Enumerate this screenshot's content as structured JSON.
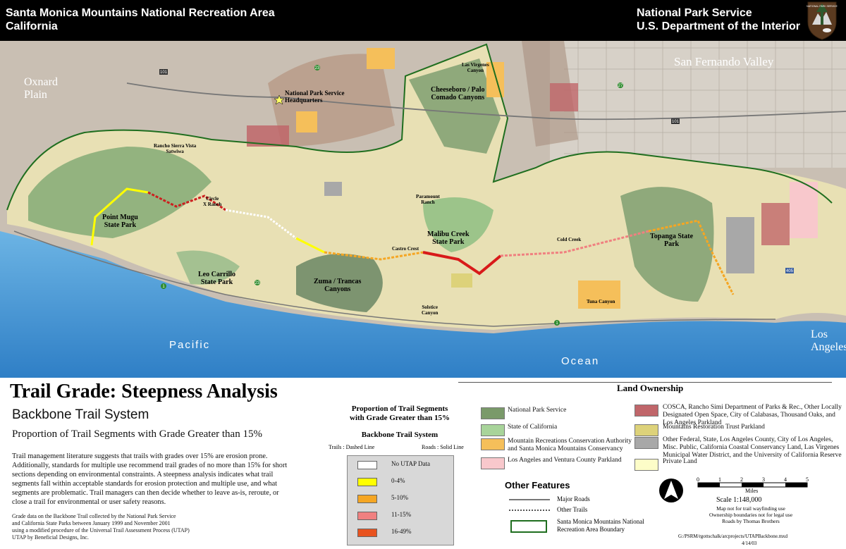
{
  "header": {
    "left_line1": "Santa Monica Mountains National Recreation Area",
    "left_line2": "California",
    "right_line1": "National Park Service",
    "right_line2": "U.S. Department of the Interior",
    "logo_text": "NATIONAL PARK SERVICE"
  },
  "map_labels": {
    "oxnard": "Oxnard\nPlain",
    "sfv": "San Fernando Valley",
    "los_angeles": "Los\nAngeles",
    "pacific": "Pacific",
    "ocean": "Ocean",
    "hq": "National Park Service\nHeadquarters",
    "las_virgenes": "Las Virgenes\nCanyon",
    "cheeseboro": "Cheeseboro / Palo\nComado Canyons",
    "rancho": "Rancho Sierra Vista\nSatwiwa",
    "circle_x": "Circle\nX Ranch",
    "point_mugu": "Point Mugu\nState Park",
    "paramount": "Paramount\nRanch",
    "malibu_creek": "Malibu Creek\nState Park",
    "castro_crest": "Castro Crest",
    "cold_creek": "Cold Creek",
    "topanga": "Topanga State\nPark",
    "leo_carrillo": "Leo Carrillo\nState Park",
    "zuma": "Zuma / Trancas\nCanyons",
    "solstice": "Solstice\nCanyon",
    "tuna": "Tuna Canyon",
    "hwy_101a": "101",
    "hwy_101b": "101",
    "hwy_23": "23",
    "hwy_27": "27",
    "hwy_1a": "1",
    "hwy_1b": "1",
    "hwy_23b": "23",
    "hwy_405": "405"
  },
  "title_block": {
    "title": "Trail Grade:  Steepness Analysis",
    "subtitle": "Backbone Trail System",
    "subtitle2": "Proportion of Trail Segments with Grade Greater than 15%",
    "description": "Trail management literature suggests that trails with grades over 15% are erosion prone. Additionally, standards for multiple use recommend trail grades of no more than 15% for short sections depending on environmental constraints.  A steepness analysis indicates what trail segments fall within acceptable standards for erosion protection and multiple use, and what segments are problematic.  Trail managers can then decide whether to leave as-is, reroute, or close a trail for environmental or user safety reasons.",
    "credits": "Grade data on the Backbone Trail collected by the National Park Service\nand California State Parks between January 1999 and November 2001\nusing a modified procedure of the Universal Trail Assessment Process (UTAP)\nUTAP by Beneficial Designs, Inc."
  },
  "grade_legend": {
    "heading": "Proportion of Trail Segments\nwith Grade Greater than 15%",
    "system": "Backbone Trail System",
    "trails_note": "Trails : Dashed Line",
    "roads_note": "Roads : Solid Line",
    "items": [
      {
        "label": "No UTAP Data",
        "color": "#ffffff"
      },
      {
        "label": "0-4%",
        "color": "#ffff00"
      },
      {
        "label": "5-10%",
        "color": "#f5a623"
      },
      {
        "label": "11-15%",
        "color": "#f08080"
      },
      {
        "label": "16-49%",
        "color": "#e8531f"
      }
    ]
  },
  "land_ownership": {
    "heading": "Land Ownership",
    "items": [
      {
        "label": "National Park Service",
        "color": "#7a9a6a"
      },
      {
        "label": "State of California",
        "color": "#a8d49a"
      },
      {
        "label": "Mountain Recreations Conservation Authority\nand Santa Monica Mountains Conservancy",
        "color": "#f5bf5a"
      },
      {
        "label": "Los Angeles and Ventura County Parkland",
        "color": "#f8c8cc"
      },
      {
        "label": "COSCA, Rancho Simi Department of Parks & Rec., Other Locally\nDesignated Open Space, City of Calabasas, Thousand Oaks, and\nLos Angeles Parkland",
        "color": "#c0666a"
      },
      {
        "label": "Mountains Restoration Trust Parkland",
        "color": "#ddd27a"
      },
      {
        "label": "Other Federal, State, Los Angeles County, City of Los Angeles,\nMisc. Public, California Coastal Conservancy Land, Las Virgenes\nMunicipal Water District, and the University of California Reserve",
        "color": "#a8a8a8"
      },
      {
        "label": "Private Land",
        "color": "#fdfdc8"
      }
    ]
  },
  "other_features": {
    "heading": "Other Features",
    "major_roads": "Major Roads",
    "other_trails": "Other Trails",
    "boundary": "Santa Monica Mountains National\nRecreation Area Boundary"
  },
  "scale": {
    "ticks": [
      "0",
      "1",
      "2",
      "3",
      "4",
      "5"
    ],
    "unit": "Miles",
    "scale_text": "Scale  1:148,000",
    "notes": "Map not for trail wayfinding use\nOwnership boundaries not for legal use\nRoads by Thomas Brothers",
    "north": "N",
    "path": "G:/PSRM/rgottschalk/arcprojects/UTAPBackbone.mxd",
    "date": "4/14/03"
  }
}
